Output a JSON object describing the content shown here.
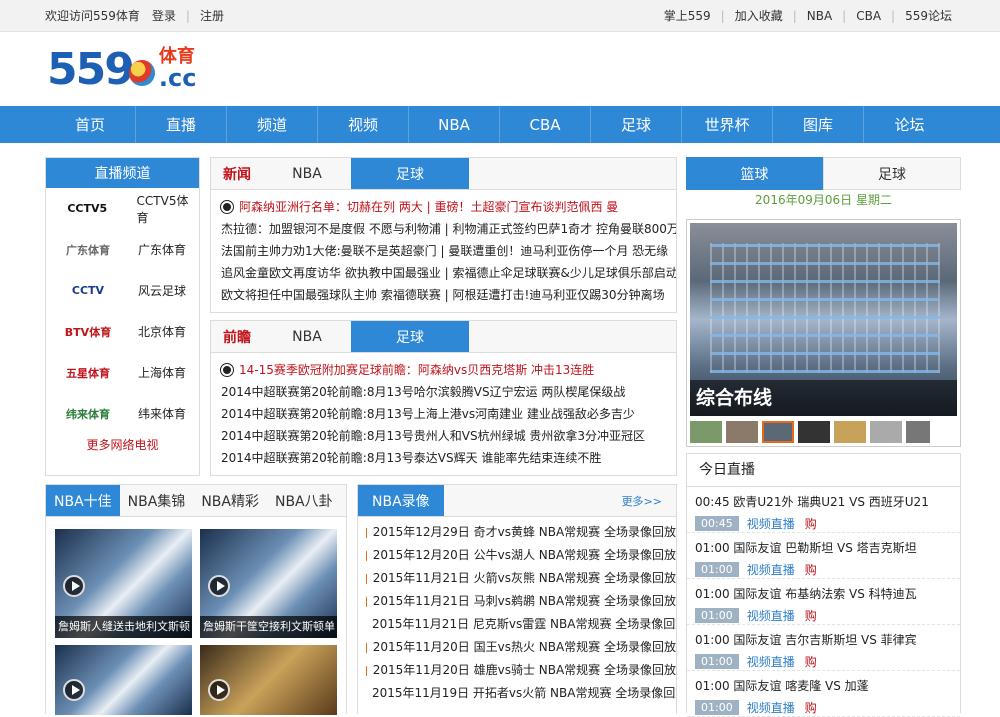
{
  "topbar": {
    "welcome": "欢迎访问559体育",
    "login": "登录",
    "register": "注册",
    "links": [
      "掌上559",
      "加入收藏",
      "NBA",
      "CBA",
      "559论坛"
    ]
  },
  "logo": {
    "num": "559",
    "cn": "体育",
    "cc": ".cc"
  },
  "nav": [
    "首页",
    "直播",
    "频道",
    "视频",
    "NBA",
    "CBA",
    "足球",
    "世界杯",
    "图库",
    "论坛"
  ],
  "live_channels": {
    "title": "直播频道",
    "items": [
      {
        "logo": "CCTV5",
        "sub": "体育",
        "name": "CCTV5体育",
        "color": "#111"
      },
      {
        "logo": "广东体育",
        "sub": "",
        "name": "广东体育",
        "color": "#666"
      },
      {
        "logo": "CCTV",
        "sub": "风云足球",
        "name": "风云足球",
        "color": "#1a3b8f"
      },
      {
        "logo": "BTV体育",
        "sub": "",
        "name": "北京体育",
        "color": "#c0131b"
      },
      {
        "logo": "五星体育",
        "sub": "",
        "name": "上海体育",
        "color": "#c0131b"
      },
      {
        "logo": "纬来体育",
        "sub": "",
        "name": "纬来体育",
        "color": "#2a7d3a"
      }
    ],
    "more": "更多网络电视"
  },
  "news": {
    "label": "新闻",
    "tabs": [
      "NBA",
      "足球"
    ],
    "lines": [
      {
        "text": "阿森纳亚洲行名单：切赫在列 两大 | 重磅！土超豪门宣布谈判范佩西 曼",
        "hl": true,
        "icon": true
      },
      {
        "text": "杰拉德：加盟银河不是度假 不愿与利物浦 | 利物浦正式签约巴萨1奇才 控角曼联800万",
        "hl": false,
        "icon": false
      },
      {
        "text": "法国前主帅力劝1大佬:曼联不是英超豪门 | 曼联遭重创！迪马利亚伤停一个月 恐无缘",
        "hl": false,
        "icon": false
      },
      {
        "text": "追风金童欧文再度访华 欲执教中国最强业 | 索福德止伞足球联赛&少儿足球俱乐部启动",
        "hl": false,
        "icon": false
      },
      {
        "text": "欧文将担任中国最强球队主帅 索福德联赛 | 阿根廷遭打击!迪马利亚仅踢30分钟离场",
        "hl": false,
        "icon": false
      }
    ]
  },
  "preview": {
    "label": "前瞻",
    "tabs": [
      "NBA",
      "足球"
    ],
    "lines": [
      {
        "text": "14-15赛季欧冠附加赛足球前瞻：阿森纳vs贝西克塔斯 冲击13连胜",
        "hl": true,
        "icon": true
      },
      {
        "text": "2014中超联赛第20轮前瞻:8月13号哈尔滨毅腾VS辽宁宏运 两队楔尾保级战",
        "hl": false,
        "icon": false
      },
      {
        "text": "2014中超联赛第20轮前瞻:8月13号上海上港vs河南建业 建业战强敌必多吉少",
        "hl": false,
        "icon": false
      },
      {
        "text": "2014中超联赛第20轮前瞻:8月13号贵州人和VS杭州绿城 贵州欲拿3分冲亚冠区",
        "hl": false,
        "icon": false
      },
      {
        "text": "2014中超联赛第20轮前瞻:8月13号泰达VS辉天 谁能率先结束连续不胜",
        "hl": false,
        "icon": false
      }
    ]
  },
  "right_tabs": {
    "active": "篮球",
    "other": "足球",
    "date": "2016年09月06日 星期二"
  },
  "gallery": {
    "caption": "综合布线"
  },
  "today_live": {
    "title": "今日直播",
    "rows": [
      {
        "title": "00:45 欧青U21外 瑞典U21 VS 西班牙U21",
        "time": "00:45",
        "link": "视频直播",
        "buy": "购"
      },
      {
        "title": "01:00 国际友谊 巴勒斯坦 VS 塔吉克斯坦",
        "time": "01:00",
        "link": "视频直播",
        "buy": "购"
      },
      {
        "title": "01:00 国际友谊 布基纳法索 VS 科特迪瓦",
        "time": "01:00",
        "link": "视频直播",
        "buy": "购"
      },
      {
        "title": "01:00 国际友谊 吉尔吉斯斯坦 VS 菲律宾",
        "time": "01:00",
        "link": "视频直播",
        "buy": "购"
      },
      {
        "title": "01:00 国际友谊 喀麦隆 VS 加蓬",
        "time": "01:00",
        "link": "视频直播",
        "buy": "购"
      }
    ]
  },
  "nba_top": {
    "tabs": [
      "NBA十佳",
      "NBA集锦",
      "NBA精彩",
      "NBA八卦"
    ],
    "thumbs": [
      "詹姆斯人缝送击地利文斯顿",
      "詹姆斯干筐空接利文斯顿单"
    ]
  },
  "nba_rec": {
    "title": "NBA录像",
    "more": "更多>>",
    "lines": [
      "2015年12月29日 奇才vs黄蜂 NBA常规赛 全场录像回放",
      "2015年12月20日 公牛vs湖人 NBA常规赛 全场录像回放",
      "2015年11月21日 火箭vs灰熊 NBA常规赛 全场录像回放",
      "2015年11月21日 马刺vs鹈鹕 NBA常规赛 全场录像回放",
      "2015年11月21日 尼克斯vs雷霆 NBA常规赛 全场录像回放",
      "2015年11月20日 国王vs热火 NBA常规赛 全场录像回放",
      "2015年11月20日 雄鹿vs骑士 NBA常规赛 全场录像回放",
      "2015年11月19日 开拓者vs火箭 NBA常规赛 全场录像回放"
    ]
  }
}
